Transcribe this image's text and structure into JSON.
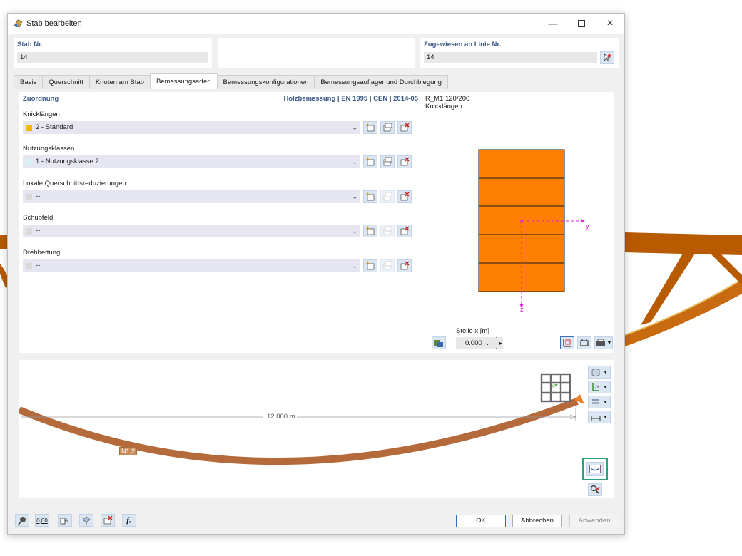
{
  "window": {
    "title": "Stab bearbeiten"
  },
  "header": {
    "member_no_label": "Stab Nr.",
    "member_no_value": "14",
    "assigned_line_label": "Zugewiesen an Linie Nr.",
    "assigned_line_value": "14"
  },
  "tabs": [
    {
      "label": "Basis"
    },
    {
      "label": "Querschnitt"
    },
    {
      "label": "Knoten am Stab"
    },
    {
      "label": "Bemessungsarten",
      "active": true
    },
    {
      "label": "Bemessungskonfigurationen"
    },
    {
      "label": "Bemessungsauflager und Durchbiegung"
    }
  ],
  "assignment": {
    "title": "Zuordnung",
    "standard": "Holzbemessung | EN 1995 | CEN | 2014-05",
    "rows": [
      {
        "label": "Knicklängen",
        "value": "2 - Standard",
        "color": "#f5b800"
      },
      {
        "label": "Nutzungsklassen",
        "value": "1 - Nutzungsklasse 2",
        "color": "#d8f0f8"
      },
      {
        "label": "Lokale Querschnittsreduzierungen",
        "value": "--",
        "color": "#d9d9d9"
      },
      {
        "label": "Schubfeld",
        "value": "--",
        "color": "#d9d9d9"
      },
      {
        "label": "Drehbettung",
        "value": "--",
        "color": "#d9d9d9"
      }
    ]
  },
  "section_preview": {
    "name": "R_M1 120/200",
    "subtitle": "Knicklängen",
    "y_axis": "y",
    "z_axis": "z",
    "location_label": "Stelle x [m]",
    "location_value": "0.000",
    "fill_color": "#ff8000"
  },
  "member_preview": {
    "length_label": "12.000 m",
    "member_label": "N1,2",
    "view_cube_label": "+Y"
  },
  "buttons": {
    "ok": "OK",
    "cancel": "Abbrechen",
    "apply": "Anwenden"
  },
  "footer_tools": {
    "units_label": "0,00"
  }
}
